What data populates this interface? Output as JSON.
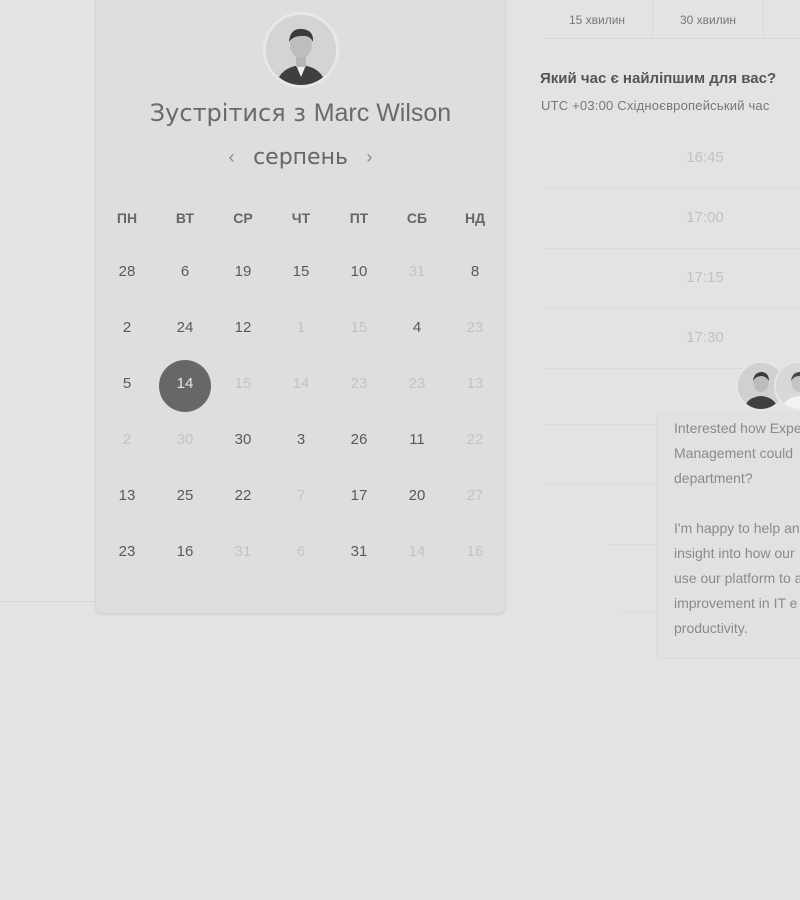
{
  "host": {
    "title_prefix": "Зустрітися з",
    "name": "Marc Wilson"
  },
  "calendar": {
    "month": "серпень",
    "prev_icon": "‹",
    "next_icon": "›",
    "weekdays": [
      "ПН",
      "ВТ",
      "СР",
      "ЧТ",
      "ПТ",
      "СБ",
      "НД"
    ],
    "weeks": [
      [
        {
          "d": "28"
        },
        {
          "d": "6"
        },
        {
          "d": "19"
        },
        {
          "d": "15"
        },
        {
          "d": "10"
        },
        {
          "d": "31",
          "dim": true
        },
        {
          "d": "8"
        }
      ],
      [
        {
          "d": "2"
        },
        {
          "d": "24"
        },
        {
          "d": "12"
        },
        {
          "d": "1",
          "dim": true
        },
        {
          "d": "15",
          "dim": true
        },
        {
          "d": "4"
        },
        {
          "d": "23",
          "dim": true
        }
      ],
      [
        {
          "d": "5"
        },
        {
          "d": "14",
          "selected": true
        },
        {
          "d": "15",
          "dim": true
        },
        {
          "d": "14",
          "dim": true
        },
        {
          "d": "23",
          "dim": true
        },
        {
          "d": "23",
          "dim": true
        },
        {
          "d": "13",
          "dim": true
        }
      ],
      [
        {
          "d": "2",
          "dim": true
        },
        {
          "d": "30",
          "dim": true
        },
        {
          "d": "30"
        },
        {
          "d": "3"
        },
        {
          "d": "26"
        },
        {
          "d": "11"
        },
        {
          "d": "22",
          "dim": true
        }
      ],
      [
        {
          "d": "13"
        },
        {
          "d": "25"
        },
        {
          "d": "22"
        },
        {
          "d": "7",
          "dim": true
        },
        {
          "d": "17"
        },
        {
          "d": "20"
        },
        {
          "d": "27",
          "dim": true
        }
      ],
      [
        {
          "d": "23"
        },
        {
          "d": "16"
        },
        {
          "d": "31",
          "dim": true
        },
        {
          "d": "6",
          "dim": true
        },
        {
          "d": "31"
        },
        {
          "d": "14",
          "dim": true
        },
        {
          "d": "16",
          "dim": true
        }
      ]
    ]
  },
  "duration_tabs": [
    "15 хвилин",
    "30 хвилин"
  ],
  "times": {
    "question": "Який час є найліпшим для вас?",
    "timezone": "UTC +03:00 Східноєвропейський час",
    "slots": [
      "16:45",
      "17:00",
      "17:15",
      "17:30"
    ]
  },
  "chat": {
    "lines": [
      "Interested how Expe",
      "Management could",
      "department?",
      "",
      "I'm happy to help an",
      "insight into how our",
      "use our platform to a",
      "improvement in IT e",
      "productivity."
    ]
  },
  "colors": {
    "background": "#e3e3e3",
    "card": "#dedede",
    "selected_day": "#676767"
  }
}
